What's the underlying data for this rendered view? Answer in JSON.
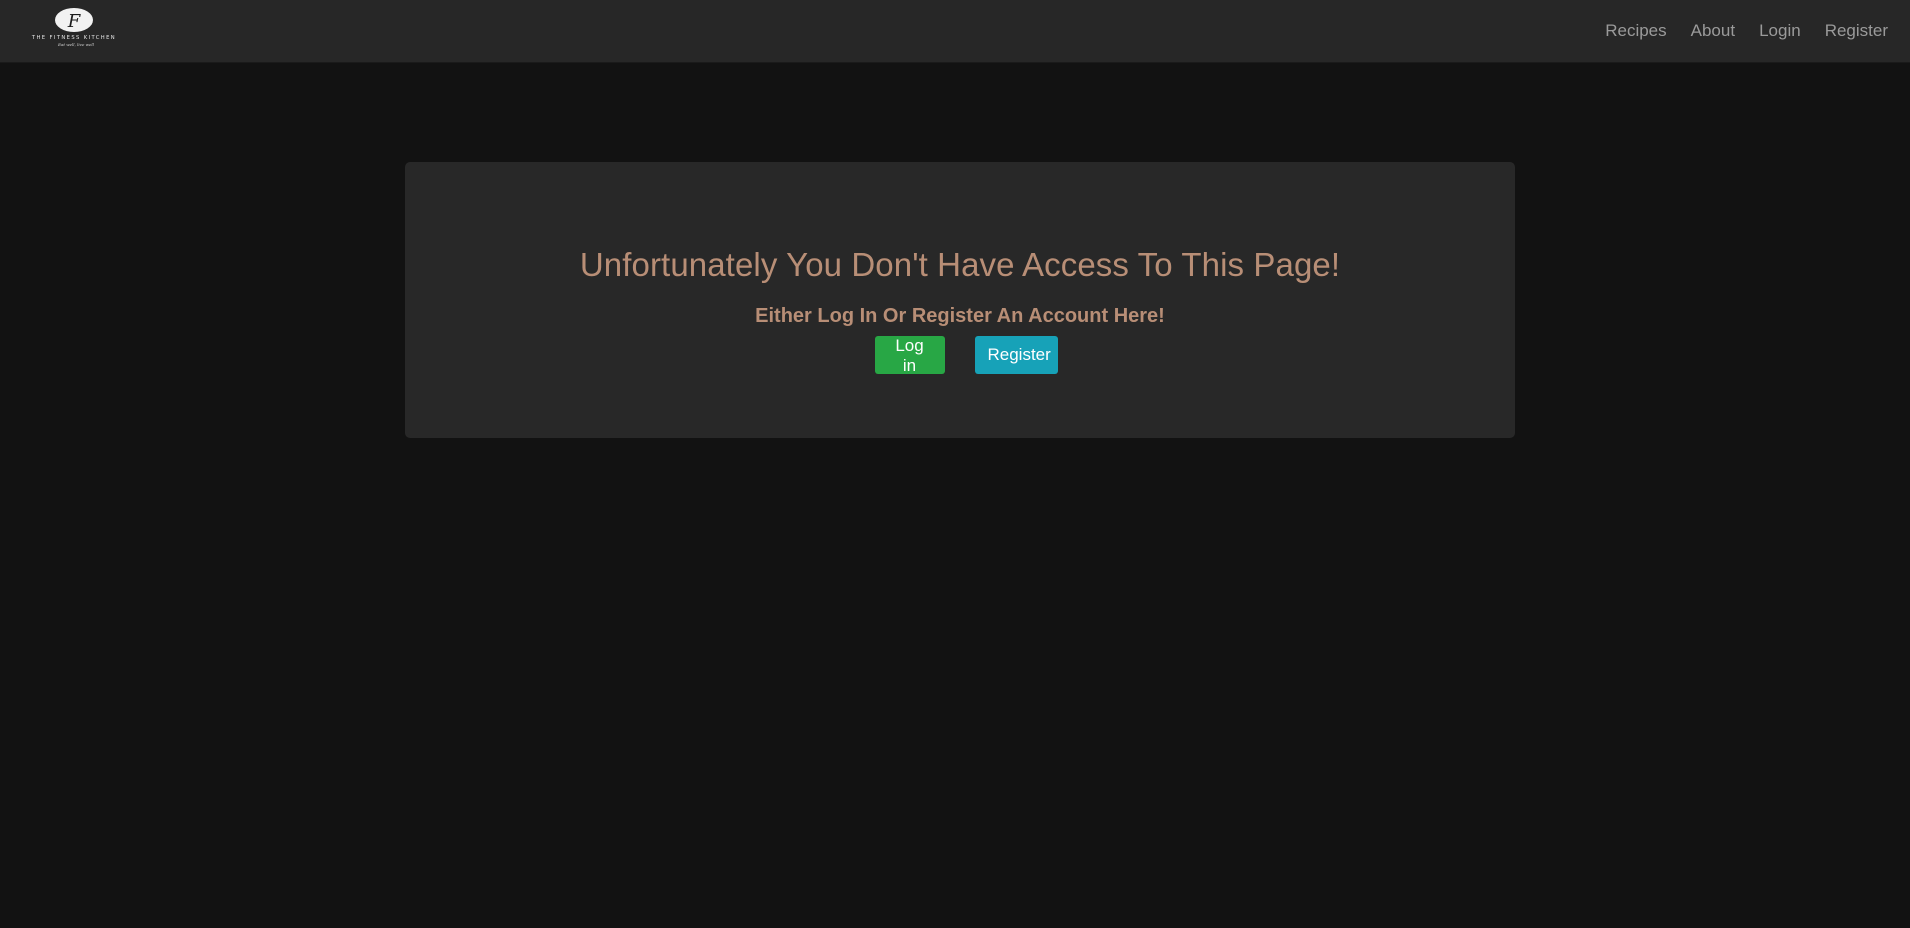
{
  "brand": {
    "logo_initial": "F",
    "name": "THE FITNESS KITCHEN",
    "tagline": "Eat well, live well"
  },
  "nav": {
    "items": [
      {
        "label": "Recipes"
      },
      {
        "label": "About"
      },
      {
        "label": "Login"
      },
      {
        "label": "Register"
      }
    ]
  },
  "main": {
    "title": "Unfortunately You Don't Have Access To This Page!",
    "subtitle": "Either Log In Or Register An Account Here!",
    "login_button": "Log in",
    "register_button": "Register"
  },
  "colors": {
    "page_bg": "#121212",
    "navbar_bg": "#272727",
    "panel_bg": "#282828",
    "heading": "#b88e76",
    "login_button": "#28a745",
    "register_button": "#17a2b8"
  }
}
